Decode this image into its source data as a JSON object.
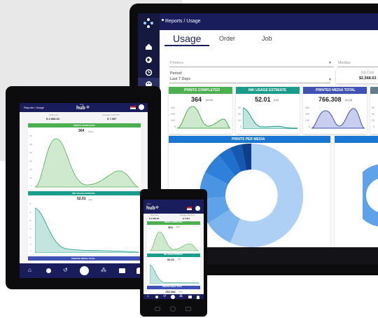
{
  "colors": {
    "navy": "#1a1d5c",
    "green": "#4caf50",
    "teal": "#1a9c8a",
    "indigo": "#3f51b5",
    "blue": "#1976d2",
    "chart_green": "#8fd08f",
    "chart_blue": "#a8c8f0"
  },
  "desktop": {
    "breadcrumb": "Reports / Usage",
    "tabs": [
      "Usage",
      "Order",
      "Job"
    ],
    "filters": {
      "printers": "Printers",
      "medias": "Medias",
      "period_label": "Period:",
      "period_value": "Last 7 Days",
      "ink_cost_label": "Ink Cost",
      "ink_cost_value": "$2,568.63"
    },
    "cards": [
      {
        "title": "PRINTS COMPLETED",
        "value": "364",
        "unit": "prints",
        "axis": [
          "300",
          "200",
          "100",
          "0"
        ]
      },
      {
        "title": "INK USAGE ESTIMATE",
        "value": "52.01",
        "unit": "(ml)",
        "axis": [
          "30",
          "20",
          "10",
          "0"
        ]
      },
      {
        "title": "PRINTED MEDIA TOTAL",
        "value": "766.308",
        "unit": "(sq.ft)",
        "axis": [
          "300",
          "200",
          "100",
          "0"
        ]
      },
      {
        "title": "",
        "value": "",
        "unit": "",
        "axis": [
          "60",
          "40",
          "20",
          "0"
        ]
      }
    ],
    "panel_title": "PRINTS PER MEDIA"
  },
  "tablet": {
    "breadcrumb": "Reports / Usage",
    "logo_top": "hmm",
    "logo": "hub",
    "total_cost_label": "Total Cost",
    "total_cost_value": "$ 2,568.63",
    "avg_cost_label": "Average Cost Print",
    "avg_cost_value": "$ 7.057",
    "prints_title": "PRINTS COMPLETED",
    "prints_value": "364",
    "prints_unit": "prints",
    "prints_axis": [
      "300",
      "250",
      "200",
      "150",
      "100",
      "50",
      "0"
    ],
    "ink_title": "INK USAGE ESTIMATE",
    "ink_value": "52.01",
    "ink_unit": "(ml)",
    "ink_axis": [
      "30",
      "25",
      "20",
      "15",
      "10",
      "5",
      "0"
    ],
    "media_title": "PRINTED MEDIA TOTAL",
    "nav_icons": [
      "home-icon",
      "globe-icon",
      "history-icon",
      "palette-icon",
      "nodes-icon",
      "printer-icon",
      "user-icon"
    ]
  },
  "phone": {
    "logo_top": "hmm",
    "logo": "hub",
    "total_cost_label": "Total Cost",
    "total_cost_value": "$ 2,568.63",
    "avg_cost_label": "Average Cost Print",
    "avg_cost_value": "$ 7.057",
    "prints_title": "PRINTS COMPLETED",
    "prints_value": "364",
    "prints_unit": "prints",
    "ink_title": "INK USAGE ESTIMATE",
    "ink_value": "52.01",
    "ink_unit": "(ml)",
    "media_title": "PRINTED MEDIA TOTAL",
    "media_value": "766.308",
    "media_unit": "sq.ft"
  }
}
